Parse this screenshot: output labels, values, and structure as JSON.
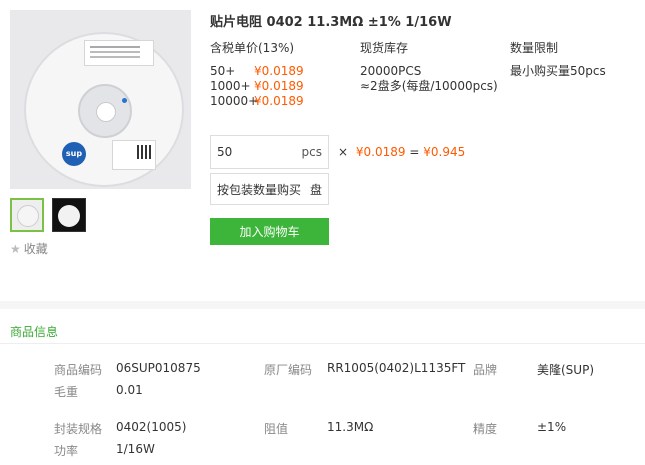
{
  "product": {
    "title": "贴片电阻 0402 11.3MΩ ±1% 1/16W",
    "favorite_label": "收藏",
    "main_image": {
      "reel_logo": "sup"
    }
  },
  "pricing": {
    "header": "含税单价(13%)",
    "tiers": [
      {
        "qty": "50+",
        "price": "¥0.0189"
      },
      {
        "qty": "1000+",
        "price": "¥0.0189"
      },
      {
        "qty": "10000+",
        "price": "¥0.0189"
      }
    ]
  },
  "stock": {
    "header": "现货库存",
    "quantity": "20000PCS",
    "reels": "≈2盘多(每盘/10000pcs)"
  },
  "limit": {
    "header": "数量限制",
    "min_order": "最小购买量50pcs"
  },
  "order": {
    "quantity": "50",
    "unit": "pcs",
    "times": "×",
    "unit_price": "¥0.0189",
    "equals": "=",
    "total": "¥0.945",
    "pack_label": "按包装数量购买",
    "pack_unit": "盘",
    "add_to_cart": "加入购物车"
  },
  "info": {
    "section_title": "商品信息",
    "specs": [
      {
        "key": "商品编码",
        "value": "06SUP010875"
      },
      {
        "key": "原厂编码",
        "value": "RR1005(0402)L1135FT"
      },
      {
        "key": "品牌",
        "value": "美隆(SUP)"
      },
      {
        "key": "毛重",
        "value": "0.01"
      },
      {
        "key": "封装规格",
        "value": "0402(1005)"
      },
      {
        "key": "阻值",
        "value": "11.3MΩ"
      },
      {
        "key": "精度",
        "value": "±1%"
      },
      {
        "key": "功率",
        "value": "1/16W"
      }
    ]
  },
  "colors": {
    "accent_green": "#3db53a",
    "price_orange": "#ff5a00",
    "section_green": "#3aa835"
  },
  "icons": {
    "favorite": "star-icon"
  }
}
